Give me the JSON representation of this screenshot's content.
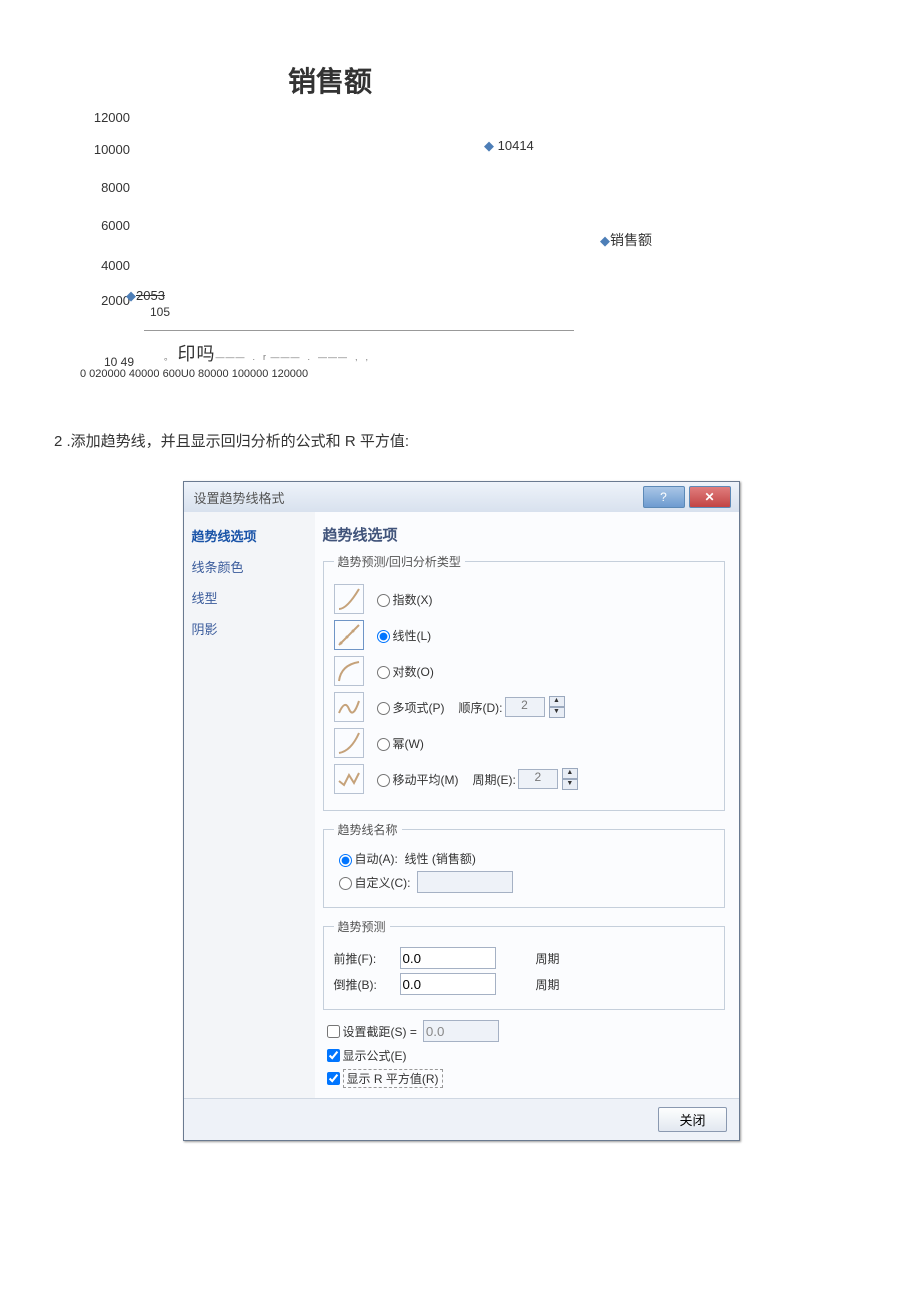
{
  "chart_data": {
    "type": "scatter",
    "title": "销售额",
    "y_ticks": [
      "12000",
      "10000",
      "8000",
      "6000",
      "4000",
      "2000"
    ],
    "x_ticks_line1": "10 49",
    "x_ticks_line2": "0 020000 40000 600U0 80000 100000 120000",
    "points": [
      {
        "x": 105,
        "y": 2053,
        "label": "2053"
      },
      {
        "x_label_only": "105"
      },
      {
        "x_approx": 80000,
        "y": 10414,
        "label": "10414"
      }
    ],
    "legend": "销售额",
    "seal_text": "印吗",
    "dot_circle": "。",
    "xlabel": "",
    "ylabel": ""
  },
  "step": {
    "num": "2",
    "text": ".添加趋势线，并且显示回归分析的公式和 R 平方值:"
  },
  "dialog": {
    "title": "设置趋势线格式",
    "help_glyph": "?",
    "close_glyph": "✕",
    "sidebar": {
      "active": "趋势线选项",
      "items": [
        "线条颜色",
        "线型",
        "阴影"
      ]
    },
    "heading": "趋势线选项",
    "type_group": {
      "legend": "趋势预测/回归分析类型",
      "options": {
        "exp": "指数(X)",
        "lin": "线性(L)",
        "log": "对数(O)",
        "poly": "多项式(P)",
        "pow": "幂(W)",
        "mavg": "移动平均(M)"
      },
      "poly_order_label": "顺序(D):",
      "poly_order_value": "2",
      "mavg_period_label": "周期(E):",
      "mavg_period_value": "2"
    },
    "name_group": {
      "legend": "趋势线名称",
      "auto_label": "自动(A):",
      "auto_value": "线性 (销售额)",
      "custom_label": "自定义(C):"
    },
    "forecast_group": {
      "legend": "趋势预测",
      "forward_label": "前推(F):",
      "forward_value": "0.0",
      "backward_label": "倒推(B):",
      "backward_value": "0.0",
      "unit": "周期"
    },
    "checks": {
      "intercept_label": "设置截距(S) =",
      "intercept_value": "0.0",
      "show_eq": "显示公式(E)",
      "show_r2": "显示 R 平方值(R)"
    },
    "close_btn": "关闭"
  }
}
